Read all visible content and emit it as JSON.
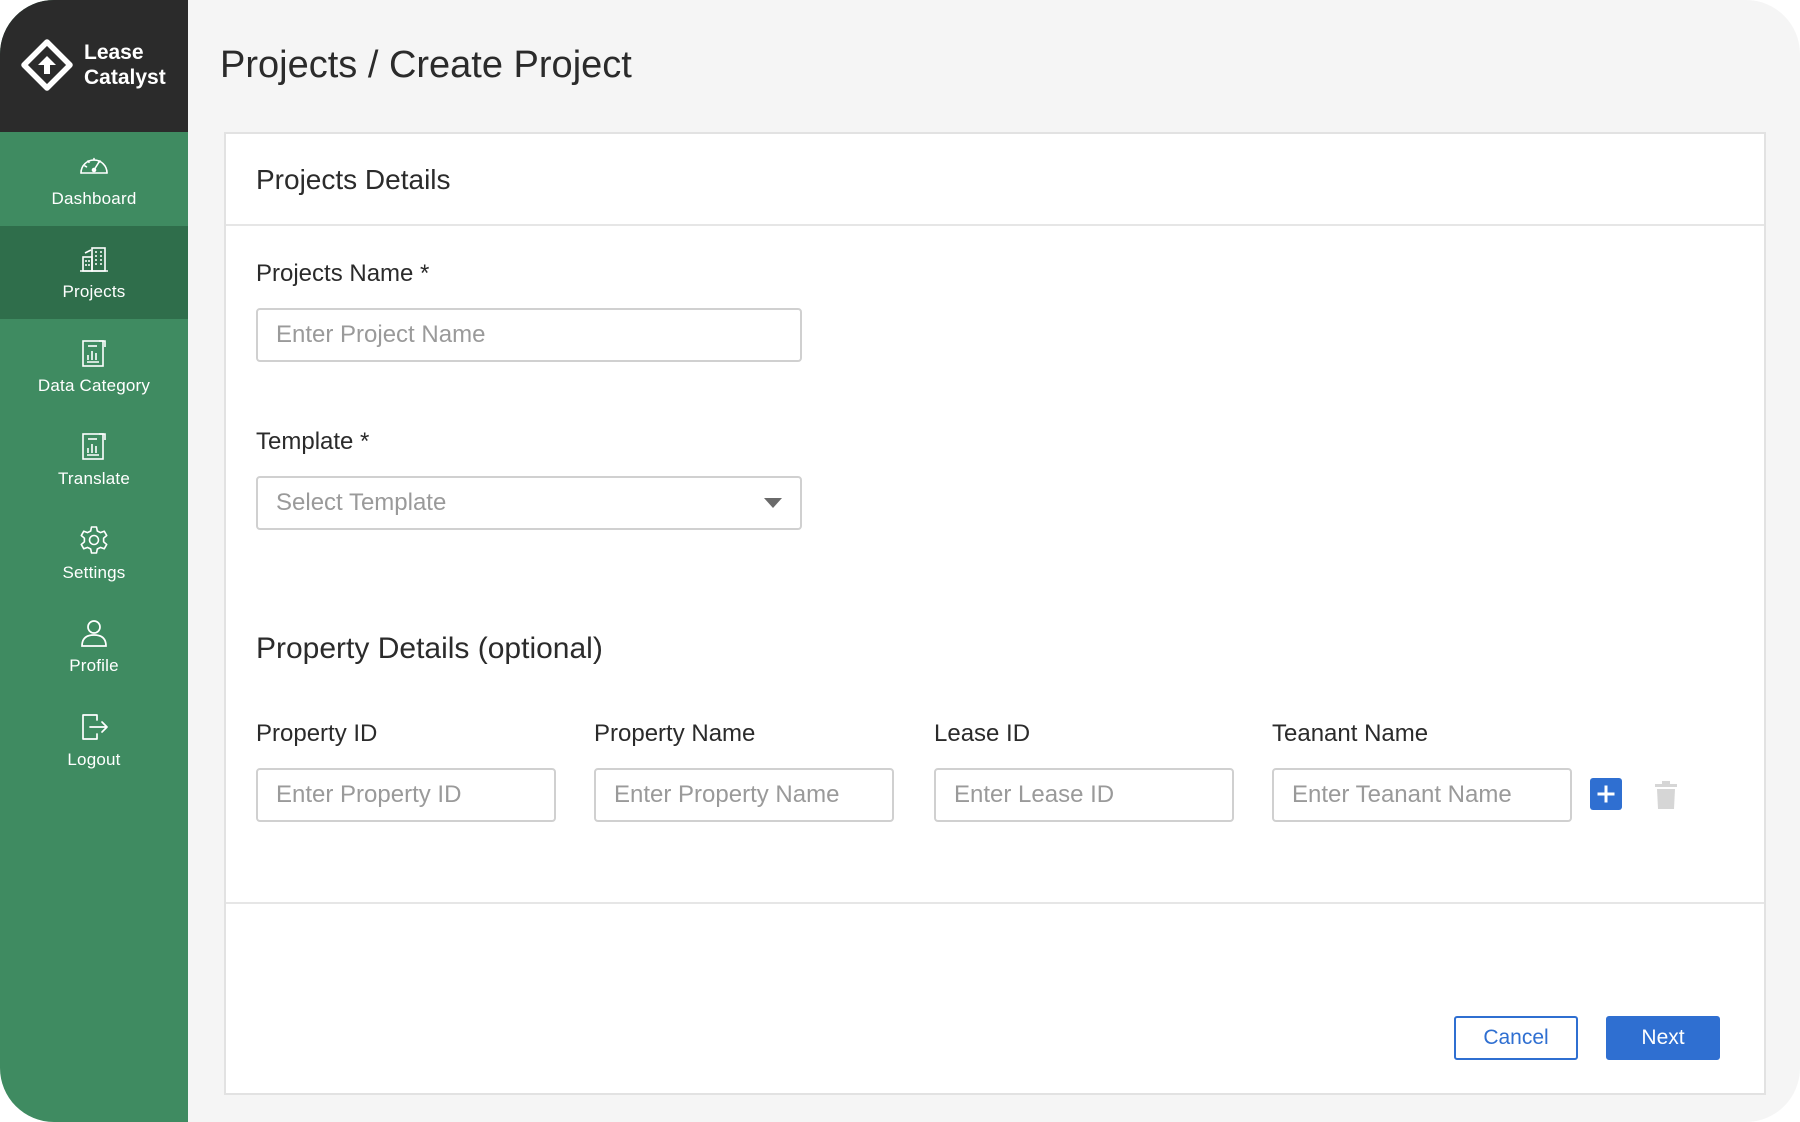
{
  "brand": {
    "line1": "Lease",
    "line2": "Catalyst"
  },
  "sidebar": {
    "items": [
      {
        "label": "Dashboard",
        "icon": "gauge-icon",
        "active": false
      },
      {
        "label": "Projects",
        "icon": "buildings-icon",
        "active": true
      },
      {
        "label": "Data Category",
        "icon": "report-icon",
        "active": false
      },
      {
        "label": "Translate",
        "icon": "document-icon",
        "active": false
      },
      {
        "label": "Settings",
        "icon": "gear-icon",
        "active": false
      },
      {
        "label": "Profile",
        "icon": "user-icon",
        "active": false
      },
      {
        "label": "Logout",
        "icon": "logout-icon",
        "active": false
      }
    ]
  },
  "header": {
    "title": "Projects / Create Project"
  },
  "form": {
    "card_title": "Projects Details",
    "project_name": {
      "label": "Projects Name *",
      "placeholder": "Enter Project Name",
      "value": ""
    },
    "template": {
      "label": "Template *",
      "placeholder": "Select Template"
    },
    "property_section": {
      "title": "Property Details (optional)",
      "property_id": {
        "label": "Property ID",
        "placeholder": "Enter Property ID"
      },
      "property_name": {
        "label": "Property Name",
        "placeholder": "Enter Property Name"
      },
      "lease_id": {
        "label": "Lease ID",
        "placeholder": "Enter Lease ID"
      },
      "tenant_name": {
        "label": "Teanant Name",
        "placeholder": "Enter Teanant Name"
      }
    },
    "actions": {
      "cancel": "Cancel",
      "next": "Next"
    }
  },
  "colors": {
    "sidebar": "#3f8b61",
    "sidebar_active": "#2f6e4b",
    "brand_bg": "#2b2b2b",
    "primary": "#2f6fd1"
  }
}
